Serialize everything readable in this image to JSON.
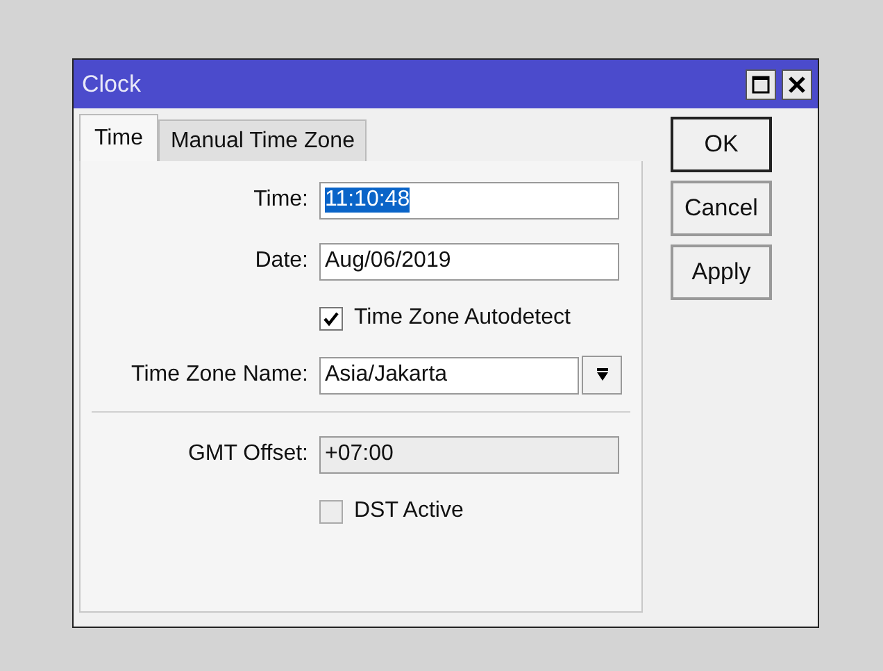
{
  "window": {
    "title": "Clock"
  },
  "tabs": [
    {
      "label": "Time",
      "selected": true
    },
    {
      "label": "Manual Time Zone",
      "selected": false
    }
  ],
  "rows": [
    {
      "kind": "text",
      "label": "Time:",
      "value": "11:10:48",
      "highlighted": true,
      "disabled": false
    },
    {
      "kind": "text",
      "label": "Date:",
      "value": "Aug/06/2019",
      "highlighted": false,
      "disabled": false
    },
    {
      "kind": "checkbox",
      "label": "Time Zone Autodetect",
      "checked": true
    },
    {
      "kind": "select",
      "label": "Time Zone Name:",
      "value": "Asia/Jakarta"
    },
    {
      "kind": "separator"
    },
    {
      "kind": "text",
      "label": "GMT Offset:",
      "value": "+07:00",
      "highlighted": false,
      "disabled": true
    },
    {
      "kind": "checkbox",
      "label": "DST Active",
      "checked": false
    }
  ],
  "buttons": [
    {
      "label": "OK",
      "default": true
    },
    {
      "label": "Cancel",
      "default": false
    },
    {
      "label": "Apply",
      "default": false
    }
  ]
}
